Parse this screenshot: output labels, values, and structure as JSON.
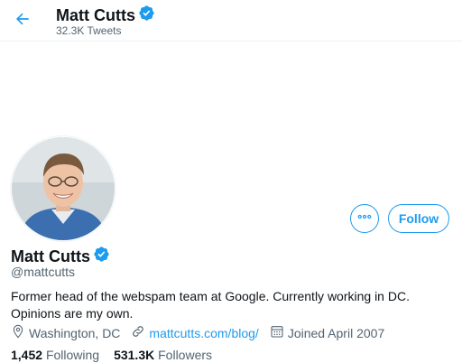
{
  "header": {
    "name": "Matt Cutts",
    "tweet_count": "32.3K Tweets"
  },
  "profile": {
    "display_name": "Matt Cutts",
    "handle": "@mattcutts",
    "bio": "Former head of the webspam team at Google. Currently working in DC. Opinions are my own.",
    "location": "Washington, DC",
    "website": "mattcutts.com/blog/",
    "joined": "Joined April 2007"
  },
  "actions": {
    "follow_label": "Follow"
  },
  "stats": {
    "following_count": "1,452",
    "following_label": "Following",
    "followers_count": "531.3K",
    "followers_label": "Followers"
  },
  "icons": {
    "back": "arrow-left-icon",
    "verified": "verified-badge-icon",
    "more": "ellipsis-icon",
    "location": "location-pin-icon",
    "link": "link-icon",
    "calendar": "calendar-icon"
  },
  "colors": {
    "accent": "#1d9bf0",
    "text_primary": "#0f1419",
    "text_secondary": "#536471"
  }
}
